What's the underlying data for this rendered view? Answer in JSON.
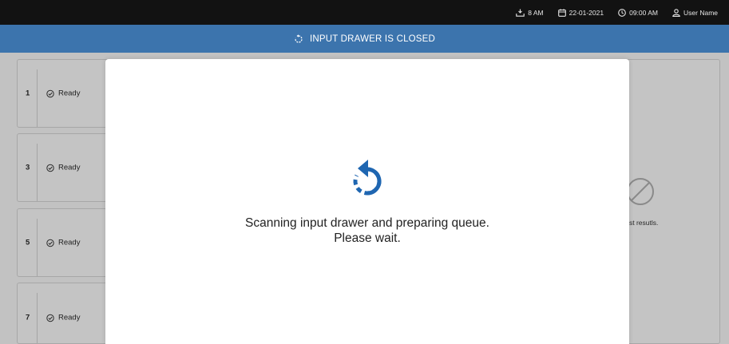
{
  "topbar": {
    "tray_icon": "tray-icon",
    "tray_label": "8 AM",
    "date_icon": "calendar-icon",
    "date": "22-01-2021",
    "time_icon": "clock-icon",
    "time": "09:00 AM",
    "user_icon": "user-icon",
    "user": "User Name"
  },
  "banner": {
    "icon": "refresh-icon",
    "text": "INPUT DRAWER IS CLOSED",
    "color": "#3c74ad"
  },
  "slots": [
    {
      "number": "1",
      "status": "Ready"
    },
    {
      "number": "3",
      "status": "Ready"
    },
    {
      "number": "5",
      "status": "Ready"
    },
    {
      "number": "7",
      "status": "Ready"
    }
  ],
  "results_panel": {
    "icon": "no-results-icon",
    "text": "st resutls."
  },
  "modal": {
    "icon": "refresh-icon",
    "line1": "Scanning input drawer and preparing queue.",
    "line2": "Please wait.",
    "accent": "#1f66b1"
  }
}
